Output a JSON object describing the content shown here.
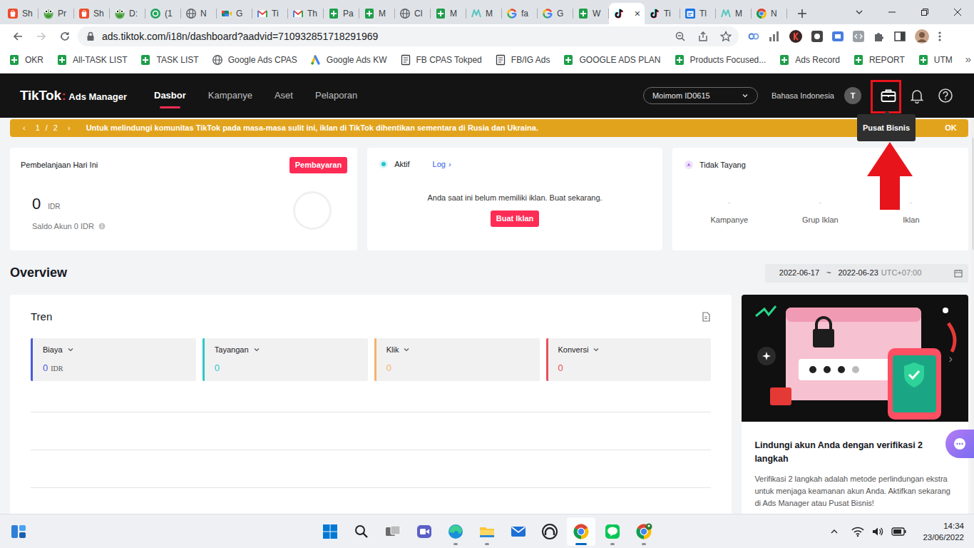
{
  "browser": {
    "tabs": [
      {
        "label": "Sh",
        "kind": "shopee",
        "selected": false
      },
      {
        "label": "Pr",
        "kind": "frog",
        "selected": false
      },
      {
        "label": "Sh",
        "kind": "shopee",
        "selected": false
      },
      {
        "label": "D:",
        "kind": "frog",
        "selected": false
      },
      {
        "label": "(1",
        "kind": "n13",
        "selected": false
      },
      {
        "label": "N",
        "kind": "globe",
        "selected": false
      },
      {
        "label": "G",
        "kind": "meet",
        "selected": false
      },
      {
        "label": "Ti",
        "kind": "gmail",
        "selected": false
      },
      {
        "label": "Th",
        "kind": "gmail",
        "selected": false
      },
      {
        "label": "Pa",
        "kind": "sheets",
        "selected": false
      },
      {
        "label": "M",
        "kind": "sheets",
        "selected": false
      },
      {
        "label": "Cl",
        "kind": "globe",
        "selected": false
      },
      {
        "label": "M",
        "kind": "sheets",
        "selected": false
      },
      {
        "label": "M",
        "kind": "mlogo",
        "selected": false
      },
      {
        "label": "fa",
        "kind": "google",
        "selected": false
      },
      {
        "label": "G",
        "kind": "google",
        "selected": false
      },
      {
        "label": "W",
        "kind": "sheets",
        "selected": false
      },
      {
        "close": "×",
        "kind": "tiktok",
        "selected": true
      },
      {
        "label": "Ti",
        "kind": "tiktok",
        "selected": false
      },
      {
        "label": "Tl",
        "kind": "calendar",
        "selected": false
      },
      {
        "label": "M",
        "kind": "mlogo",
        "selected": false
      },
      {
        "label": "N",
        "kind": "chrome",
        "selected": false
      }
    ],
    "address": "ads.tiktok.com/i18n/dashboard?aadvid=710932851718291969",
    "bookmarks": [
      {
        "label": "OKR",
        "kind": "sheets"
      },
      {
        "label": "All-TASK LIST",
        "kind": "sheets"
      },
      {
        "label": "TASK LIST",
        "kind": "sheets"
      },
      {
        "label": "Google Ads CPAS",
        "kind": "globe"
      },
      {
        "label": "Google Ads KW",
        "kind": "gads"
      },
      {
        "label": "FB CPAS Tokped",
        "kind": "doc"
      },
      {
        "label": "FB/IG Ads",
        "kind": "doc"
      },
      {
        "label": "GOOGLE ADS PLAN",
        "kind": "sheets"
      },
      {
        "label": "Products Focused...",
        "kind": "sheets"
      },
      {
        "label": "Ads Record",
        "kind": "sheets"
      },
      {
        "label": "REPORT",
        "kind": "sheets"
      },
      {
        "label": "UTM",
        "kind": "sheets"
      }
    ],
    "bookmarks_more": "»"
  },
  "app": {
    "logo_brand": "TikTok",
    "logo_separator": ":",
    "logo_product": "Ads Manager",
    "nav": [
      {
        "label": "Dasbor",
        "selected": true
      },
      {
        "label": "Kampanye",
        "selected": false
      },
      {
        "label": "Aset",
        "selected": false
      },
      {
        "label": "Pelaporan",
        "selected": false
      }
    ],
    "account": "Moimom ID0615",
    "language": "Bahasa Indonesia",
    "avatar": "T",
    "tooltip": "Pusat Bisnis"
  },
  "banner": {
    "prev": "‹",
    "page": "1",
    "separator": "/",
    "total": "2",
    "next": "›",
    "text": "Untuk melindungi komunitas TikTok pada masa-masa sulit ini, iklan di TikTok dihentikan sementara di Rusia dan Ukraina.",
    "ok": "OK"
  },
  "spend": {
    "title": "Pembelanjaan Hari Ini",
    "button": "Pembayaran",
    "amount": "0",
    "currency": "IDR",
    "balance": "Saldo Akun 0 IDR"
  },
  "active": {
    "title": "Aktif",
    "log": "Log",
    "log_arrow": "›",
    "message": "Anda saat ini belum memiliki iklan. Buat sekarang.",
    "button": "Buat Iklan"
  },
  "not_delivering": {
    "title": "Tidak Tayang",
    "items": [
      {
        "value": "-",
        "label": "Kampanye"
      },
      {
        "value": "-",
        "label": "Grup Iklan"
      },
      {
        "value": "-",
        "label": "Iklan"
      }
    ]
  },
  "overview": {
    "title": "Overview",
    "date_from": "2022-06-17",
    "date_separator": "~",
    "date_to": "2022-06-23",
    "timezone": "UTC+07:00"
  },
  "trend": {
    "title": "Tren",
    "metrics": [
      {
        "label": "Biaya",
        "value": "0",
        "unit": "IDR",
        "color": "#4b5bd6"
      },
      {
        "label": "Tayangan",
        "value": "0",
        "color": "#2ec7c9"
      },
      {
        "label": "Klik",
        "value": "0",
        "color": "#f5b26b"
      },
      {
        "label": "Konversi",
        "value": "0",
        "color": "#e8505b"
      }
    ]
  },
  "promo": {
    "title": "Lindungi akun Anda dengan verifikasi 2 langkah",
    "text": "Verifikasi 2 langkah adalah metode perlindungan ekstra untuk menjaga keamanan akun Anda. Aktifkan sekarang di Ads Manager atau Pusat Bisnis!",
    "next": "›"
  },
  "taskbar": {
    "apps": [
      {
        "kind": "start",
        "running": false,
        "selected": false
      },
      {
        "kind": "search",
        "running": false,
        "selected": false
      },
      {
        "kind": "taskview",
        "running": false,
        "selected": false
      },
      {
        "kind": "teams",
        "running": false,
        "selected": false
      },
      {
        "kind": "edge",
        "running": true,
        "selected": false
      },
      {
        "kind": "explorer",
        "running": true,
        "selected": false
      },
      {
        "kind": "mail",
        "running": false,
        "selected": false
      },
      {
        "kind": "arch",
        "running": false,
        "selected": false
      },
      {
        "kind": "chrome",
        "running": true,
        "selected": true
      },
      {
        "kind": "line",
        "running": true,
        "selected": false
      },
      {
        "kind": "chromeprofile",
        "running": true,
        "selected": false
      }
    ],
    "time": "14:34",
    "date": "23/06/2022"
  }
}
